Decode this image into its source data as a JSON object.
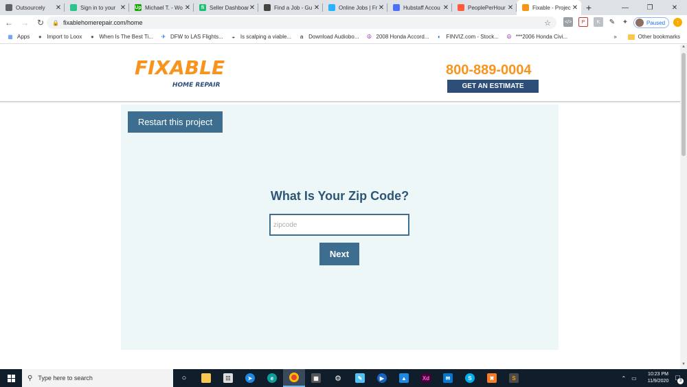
{
  "browser": {
    "tabs": [
      {
        "title": "Outsourcely",
        "fav_color": "#5f6368",
        "icon": "person-icon"
      },
      {
        "title": "Sign in to your",
        "fav_color": "#2bc48a",
        "icon": "square-icon"
      },
      {
        "title": "Michael T. - Wo",
        "fav_color": "#14a800",
        "icon": "upwork-icon",
        "glyph": "Up"
      },
      {
        "title": "Seller Dashboar",
        "fav_color": "#1dbf73",
        "icon": "fiverr-icon",
        "glyph": "fi"
      },
      {
        "title": "Find a Job - Gu",
        "fav_color": "#444",
        "icon": "guru-icon"
      },
      {
        "title": "Online Jobs | Fr",
        "fav_color": "#29b2fe",
        "icon": "freelancer-icon"
      },
      {
        "title": "Hubstaff Accou",
        "fav_color": "#4f6ef7",
        "icon": "hubstaff-icon"
      },
      {
        "title": "PeoplePerHour",
        "fav_color": "#ff5a3c",
        "icon": "pph-icon"
      },
      {
        "title": "Fixable - Projec",
        "fav_color": "#f7941d",
        "icon": "fixable-icon",
        "active": true
      }
    ],
    "url": "fixablehomerepair.com/home",
    "profile_label": "Paused",
    "bookmarks": [
      {
        "label": "Apps",
        "icon": "apps-grid-icon"
      },
      {
        "label": "Import to Loox",
        "icon": "globe-icon"
      },
      {
        "label": "When Is The Best Ti...",
        "icon": "globe-icon"
      },
      {
        "label": "DFW to LAS Flights...",
        "icon": "plane-icon"
      },
      {
        "label": "Is scalping a viable...",
        "icon": "chart-icon"
      },
      {
        "label": "Download Audiobo...",
        "icon": "amazon-icon"
      },
      {
        "label": "2008 Honda Accord...",
        "icon": "peace-icon"
      },
      {
        "label": "FINVIZ.com - Stock...",
        "icon": "finviz-icon"
      },
      {
        "label": "***2006 Honda Civi...",
        "icon": "peace-icon"
      }
    ],
    "bookmarks_more": "»",
    "other_bookmarks": "Other bookmarks"
  },
  "site": {
    "logo_word": "FIXABLE",
    "logo_sub": "HOME REPAIR",
    "phone": "800-889-0004",
    "estimate_label": "GET AN ESTIMATE",
    "brand_orange": "#f7941d",
    "brand_navy": "#2d4e79"
  },
  "form": {
    "restart_label": "Restart this project",
    "question": "What Is Your Zip Code?",
    "zip_placeholder": "zipcode",
    "zip_value": "",
    "next_label": "Next"
  },
  "taskbar": {
    "search_placeholder": "Type here to search",
    "time": "10:23 PM",
    "date": "11/9/2020",
    "notification_count": "3"
  }
}
